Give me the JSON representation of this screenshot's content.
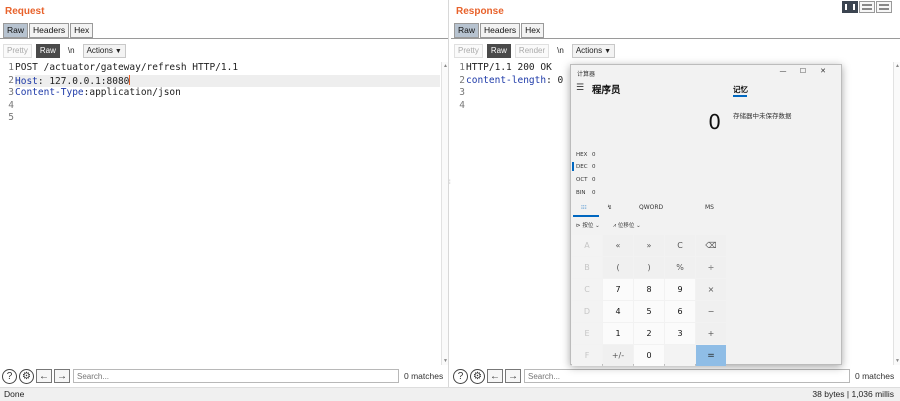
{
  "request": {
    "title": "Request",
    "tabs": [
      "Raw",
      "Headers",
      "Hex"
    ],
    "toolbar": {
      "pretty": "Pretty",
      "raw": "Raw",
      "newline": "\\n",
      "actions": "Actions"
    },
    "lines": [
      {
        "n": "1",
        "text": "POST /actuator/gateway/refresh HTTP/1.1"
      },
      {
        "n": "2",
        "key": "Host",
        "val": ": 127.0.0.1:8080"
      },
      {
        "n": "3",
        "key": "Content-Type",
        "val": ":application/json"
      },
      {
        "n": "4",
        "text": ""
      },
      {
        "n": "5",
        "text": ""
      }
    ],
    "search_placeholder": "Search...",
    "matches": "0 matches"
  },
  "response": {
    "title": "Response",
    "tabs": [
      "Raw",
      "Headers",
      "Hex"
    ],
    "toolbar": {
      "pretty": "Pretty",
      "raw": "Raw",
      "render": "Render",
      "newline": "\\n",
      "actions": "Actions"
    },
    "lines": [
      {
        "n": "1",
        "text": "HTTP/1.1 200 OK"
      },
      {
        "n": "2",
        "key": "content-length",
        "val": ": 0"
      },
      {
        "n": "3",
        "text": ""
      },
      {
        "n": "4",
        "text": ""
      }
    ],
    "search_placeholder": "Search...",
    "matches": "0 matches"
  },
  "status": {
    "left": "Done",
    "right": "38 bytes | 1,036 millis"
  },
  "calculator": {
    "window_title": "计算器",
    "window_controls": [
      "—",
      "☐",
      "✕"
    ],
    "menu_glyph": "☰",
    "mode": "程序员",
    "memory_tab": "记忆",
    "memory_empty": "存储器中未保存数据",
    "display": "0",
    "radix": [
      {
        "label": "HEX",
        "value": "0"
      },
      {
        "label": "DEC",
        "value": "0"
      },
      {
        "label": "OCT",
        "value": "0"
      },
      {
        "label": "BIN",
        "value": "0"
      }
    ],
    "tabs": [
      "⁝⁝⁝",
      "↯",
      "QWORD",
      "MS"
    ],
    "selectors": [
      "按位",
      "位移位"
    ],
    "keys": [
      [
        "A",
        "«",
        "»",
        "C",
        "⌫"
      ],
      [
        "B",
        "(",
        ")",
        "%",
        "÷"
      ],
      [
        "C",
        "7",
        "8",
        "9",
        "×"
      ],
      [
        "D",
        "4",
        "5",
        "6",
        "−"
      ],
      [
        "E",
        "1",
        "2",
        "3",
        "+"
      ],
      [
        "F",
        "+/-",
        "0",
        "",
        "="
      ]
    ]
  }
}
